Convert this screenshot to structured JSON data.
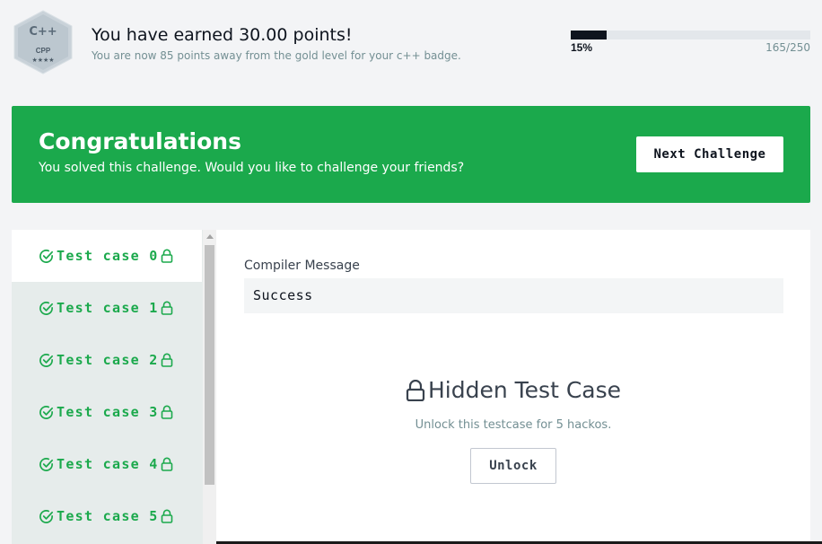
{
  "badge": {
    "lang_glyph": "C++",
    "lang_name": "CPP",
    "stars": "★★★★"
  },
  "header": {
    "title": "You have earned 30.00 points!",
    "subtitle": "You are now 85 points away from the gold level for your c++ badge.",
    "progress_percent_label": "15%",
    "progress_fraction": 0.15,
    "progress_count": "165/250"
  },
  "banner": {
    "title": "Congratulations",
    "subtitle": "You solved this challenge. Would you like to challenge your friends?",
    "next_button": "Next Challenge",
    "color": "#1ba94c"
  },
  "test_cases": [
    {
      "label": "Test case 0",
      "status": "passed",
      "locked": true,
      "active": true
    },
    {
      "label": "Test case 1",
      "status": "passed",
      "locked": true,
      "active": false
    },
    {
      "label": "Test case 2",
      "status": "passed",
      "locked": true,
      "active": false
    },
    {
      "label": "Test case 3",
      "status": "passed",
      "locked": true,
      "active": false
    },
    {
      "label": "Test case 4",
      "status": "passed",
      "locked": true,
      "active": false
    },
    {
      "label": "Test case 5",
      "status": "passed",
      "locked": true,
      "active": false
    }
  ],
  "result": {
    "compiler_label": "Compiler Message",
    "compiler_message": "Success",
    "hidden_title": "Hidden Test Case",
    "hidden_sub": "Unlock this testcase for 5 hackos.",
    "unlock_button": "Unlock"
  },
  "icons": {
    "check": "check-circle-icon",
    "lock": "lock-icon"
  }
}
